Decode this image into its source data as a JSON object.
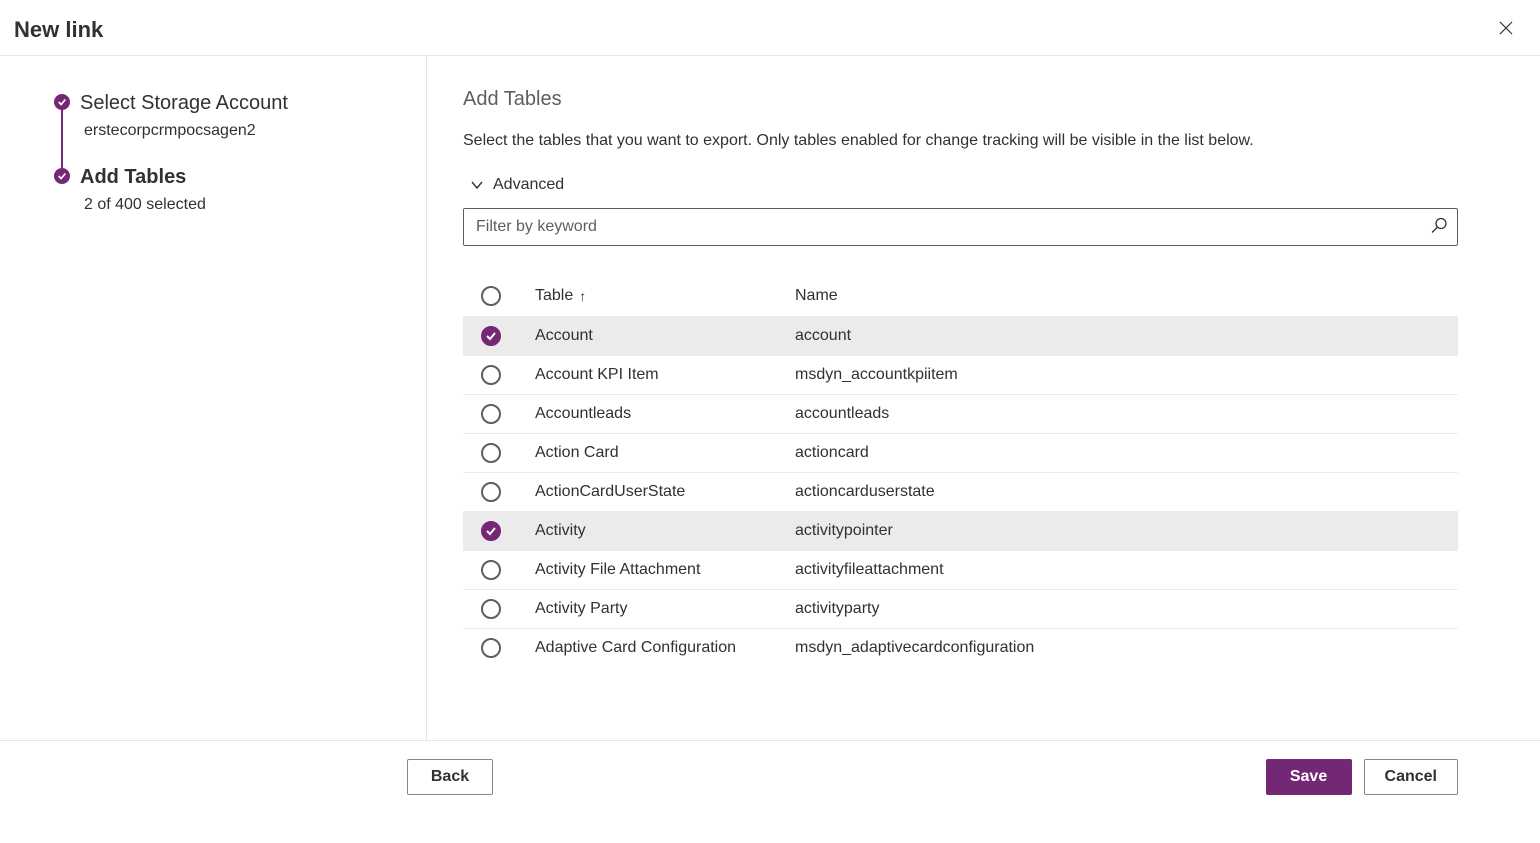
{
  "header": {
    "title": "New link"
  },
  "sidebar": {
    "steps": [
      {
        "title": "Select Storage Account",
        "sub": "erstecorpcrmpocsagen2",
        "active": false
      },
      {
        "title": "Add Tables",
        "sub": "2 of 400 selected",
        "active": true
      }
    ]
  },
  "main": {
    "heading": "Add Tables",
    "description": "Select the tables that you want to export. Only tables enabled for change tracking will be visible in the list below.",
    "advanced_label": "Advanced",
    "search_placeholder": "Filter by keyword",
    "columns": {
      "check": "",
      "label": "Table",
      "name": "Name",
      "sort_indicator": "↑"
    },
    "rows": [
      {
        "label": "Account",
        "name": "account",
        "selected": true
      },
      {
        "label": "Account KPI Item",
        "name": "msdyn_accountkpiitem",
        "selected": false
      },
      {
        "label": "Accountleads",
        "name": "accountleads",
        "selected": false
      },
      {
        "label": "Action Card",
        "name": "actioncard",
        "selected": false
      },
      {
        "label": "ActionCardUserState",
        "name": "actioncarduserstate",
        "selected": false
      },
      {
        "label": "Activity",
        "name": "activitypointer",
        "selected": true
      },
      {
        "label": "Activity File Attachment",
        "name": "activityfileattachment",
        "selected": false
      },
      {
        "label": "Activity Party",
        "name": "activityparty",
        "selected": false
      },
      {
        "label": "Adaptive Card Configuration",
        "name": "msdyn_adaptivecardconfiguration",
        "selected": false
      }
    ]
  },
  "footer": {
    "back": "Back",
    "save": "Save",
    "cancel": "Cancel"
  }
}
